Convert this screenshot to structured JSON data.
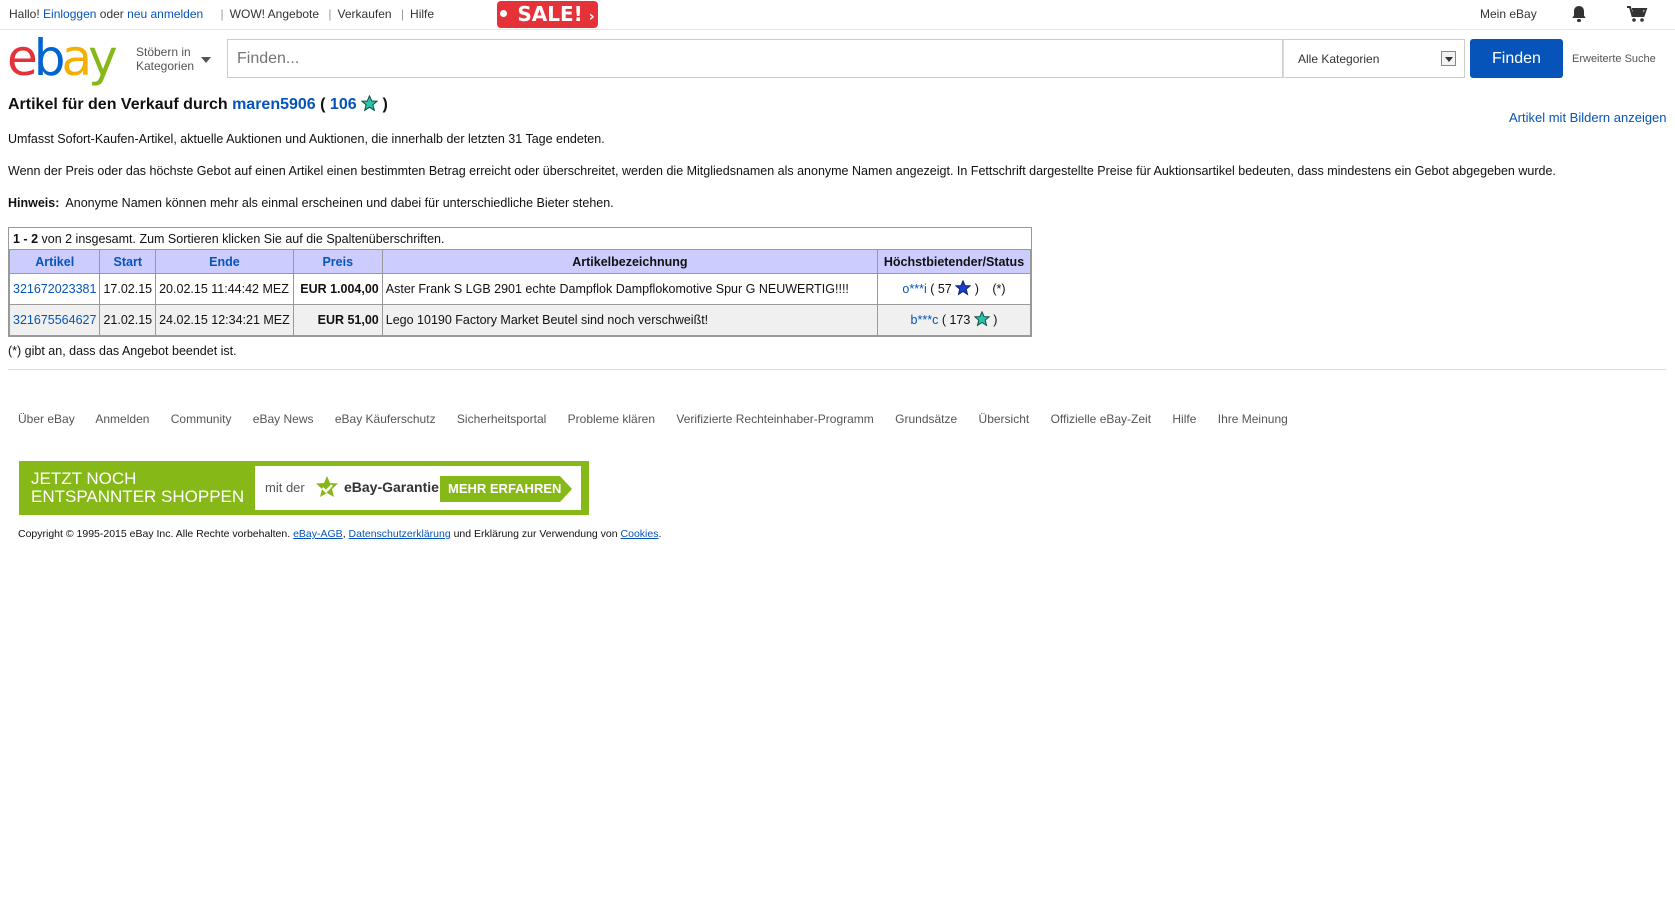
{
  "topbar": {
    "greeting": "Hallo!",
    "login": "Einloggen",
    "or": "oder",
    "register": "neu anmelden",
    "wow": "WOW! Angebote",
    "sell": "Verkaufen",
    "help": "Hilfe",
    "sale": "SALE!",
    "my_ebay": "Mein eBay"
  },
  "header": {
    "logo": [
      "e",
      "b",
      "a",
      "y"
    ],
    "logo_colors": [
      "#e53238",
      "#0064d2",
      "#f5af02",
      "#86b817"
    ],
    "browse_line1": "Stöbern in",
    "browse_line2": "Kategorien",
    "search_placeholder": "Finden...",
    "category": "Alle Kategorien",
    "find_button": "Finden",
    "advanced_search": "Erweiterte Suche"
  },
  "page": {
    "heading_prefix": "Artikel für den Verkauf durch",
    "seller": "maren5906",
    "open_paren": "(",
    "feedback": "106",
    "close_paren": ")",
    "show_with_pictures": "Artikel mit Bildern anzeigen",
    "para1": "Umfasst Sofort-Kaufen-Artikel, aktuelle Auktionen und Auktionen, die innerhalb der letzten 31 Tage endeten.",
    "para2": "Wenn der Preis oder das höchste Gebot auf einen Artikel einen bestimmten Betrag erreicht oder überschreitet, werden die Mitgliedsnamen als anonyme Namen angezeigt. In Fettschrift dargestellte Preise für Auktionsartikel bedeuten, dass mindestens ein Gebot abgegeben wurde.",
    "hint_label": "Hinweis:",
    "hint_text": "Anonyme Namen können mehr als einmal erscheinen und dabei für unterschiedliche Bieter stehen."
  },
  "table": {
    "range_start": "1",
    "range_sep": " - ",
    "range_end": "2",
    "count_text": " von 2 insgesamt. Zum Sortieren klicken Sie auf die Spaltenüberschriften.",
    "headers": [
      "Artikel",
      "Start",
      "Ende",
      "Preis",
      "Artikelbezeichnung",
      "Höchstbietender/Status"
    ],
    "rows": [
      {
        "item": "321672023381",
        "start": "17.02.15",
        "end": "20.02.15 11:44:42 MEZ",
        "price": "EUR 1.004,00",
        "title": "Aster Frank S LGB 2901 echte Dampflok Dampflokomotive Spur G NEUWERTIG!!!!",
        "bidder": "o***i",
        "bidder_score": "( 57",
        "close": ")",
        "status": "(*)",
        "star_color": "#1a3fcf"
      },
      {
        "item": "321675564627",
        "start": "21.02.15",
        "end": "24.02.15 12:34:21 MEZ",
        "price": "EUR 51,00",
        "title": "Lego 10190 Factory Market Beutel sind noch verschweißt!",
        "bidder": "b***c",
        "bidder_score": "( 173",
        "close": ")",
        "status": "",
        "star_color": "#2bc4a8"
      }
    ],
    "note": "(*) gibt an, dass das Angebot beendet ist."
  },
  "footer": {
    "links": [
      "Über eBay",
      "Anmelden",
      "Community",
      "eBay News",
      "eBay Käuferschutz",
      "Sicherheitsportal",
      "Probleme klären",
      "Verifizierte Rechteinhaber-Programm",
      "Grundsätze",
      "Übersicht",
      "Offizielle eBay-Zeit",
      "Hilfe",
      "Ihre Meinung"
    ],
    "banner_line1": "JETZT NOCH",
    "banner_line2": "ENTSPANNTER SHOPPEN",
    "banner_mitder": "mit der",
    "banner_garantie": "eBay-Garantie",
    "banner_cta": "MEHR ERFAHREN",
    "copyright": "Copyright © 1995-2015 eBay Inc. Alle Rechte vorbehalten.",
    "agb": "eBay-AGB",
    "comma": ",",
    "privacy": "Datenschutzerklärung",
    "and_text": "und Erklärung zur Verwendung von",
    "cookies": "Cookies",
    "period": "."
  }
}
